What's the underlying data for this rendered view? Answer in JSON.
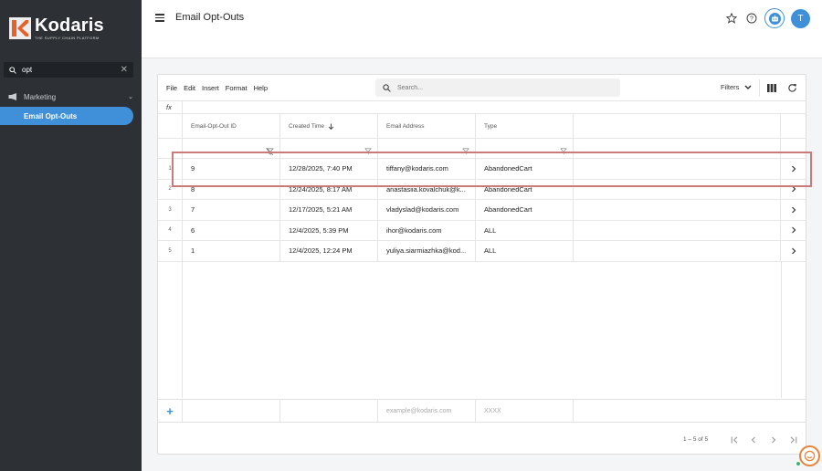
{
  "brand": {
    "name": "Kodaris",
    "tagline": "THE SUPPLY CHAIN PLATFORM"
  },
  "sidebar": {
    "search_value": "opt",
    "section": {
      "label": "Marketing",
      "icon": "megaphone-icon"
    },
    "active_item": "Email Opt-Outs"
  },
  "header": {
    "title": "Email Opt-Outs",
    "avatar_initial": "T"
  },
  "toolbar": {
    "menu": [
      "File",
      "Edit",
      "Insert",
      "Format",
      "Help"
    ],
    "search_placeholder": "Search...",
    "filters_label": "Filters"
  },
  "formula_bar": {
    "label": "fx"
  },
  "table": {
    "columns": [
      "Email-Opt-Out ID",
      "Created Time",
      "Email Address",
      "Type"
    ],
    "sort": {
      "column": "Created Time",
      "direction": "desc"
    },
    "rows": [
      {
        "rn": "1",
        "id": "9",
        "created": "12/28/2025, 7:40 PM",
        "email": "tiffany@kodaris.com",
        "type": "AbandonedCart"
      },
      {
        "rn": "2",
        "id": "8",
        "created": "12/24/2025, 8:17 AM",
        "email": "anastasiia.kovalchuk@k...",
        "type": "AbandonedCart"
      },
      {
        "rn": "3",
        "id": "7",
        "created": "12/17/2025, 5:21 AM",
        "email": "vladyslad@kodaris.com",
        "type": "AbandonedCart"
      },
      {
        "rn": "4",
        "id": "6",
        "created": "12/4/2025, 5:39 PM",
        "email": "ihor@kodaris.com",
        "type": "ALL"
      },
      {
        "rn": "5",
        "id": "1",
        "created": "12/4/2025, 12:24 PM",
        "email": "yuliya.siarmiazhka@kod...",
        "type": "ALL"
      }
    ],
    "new_row": {
      "email_placeholder": "example@kodaris.com",
      "type_placeholder": "XXXX"
    }
  },
  "pagination": {
    "text": "1 – 5 of 5"
  },
  "colors": {
    "accent": "#3f8fd9",
    "sidebar_bg": "#2d3135",
    "highlight": "#c97b7b",
    "chat": "#e8833a"
  }
}
